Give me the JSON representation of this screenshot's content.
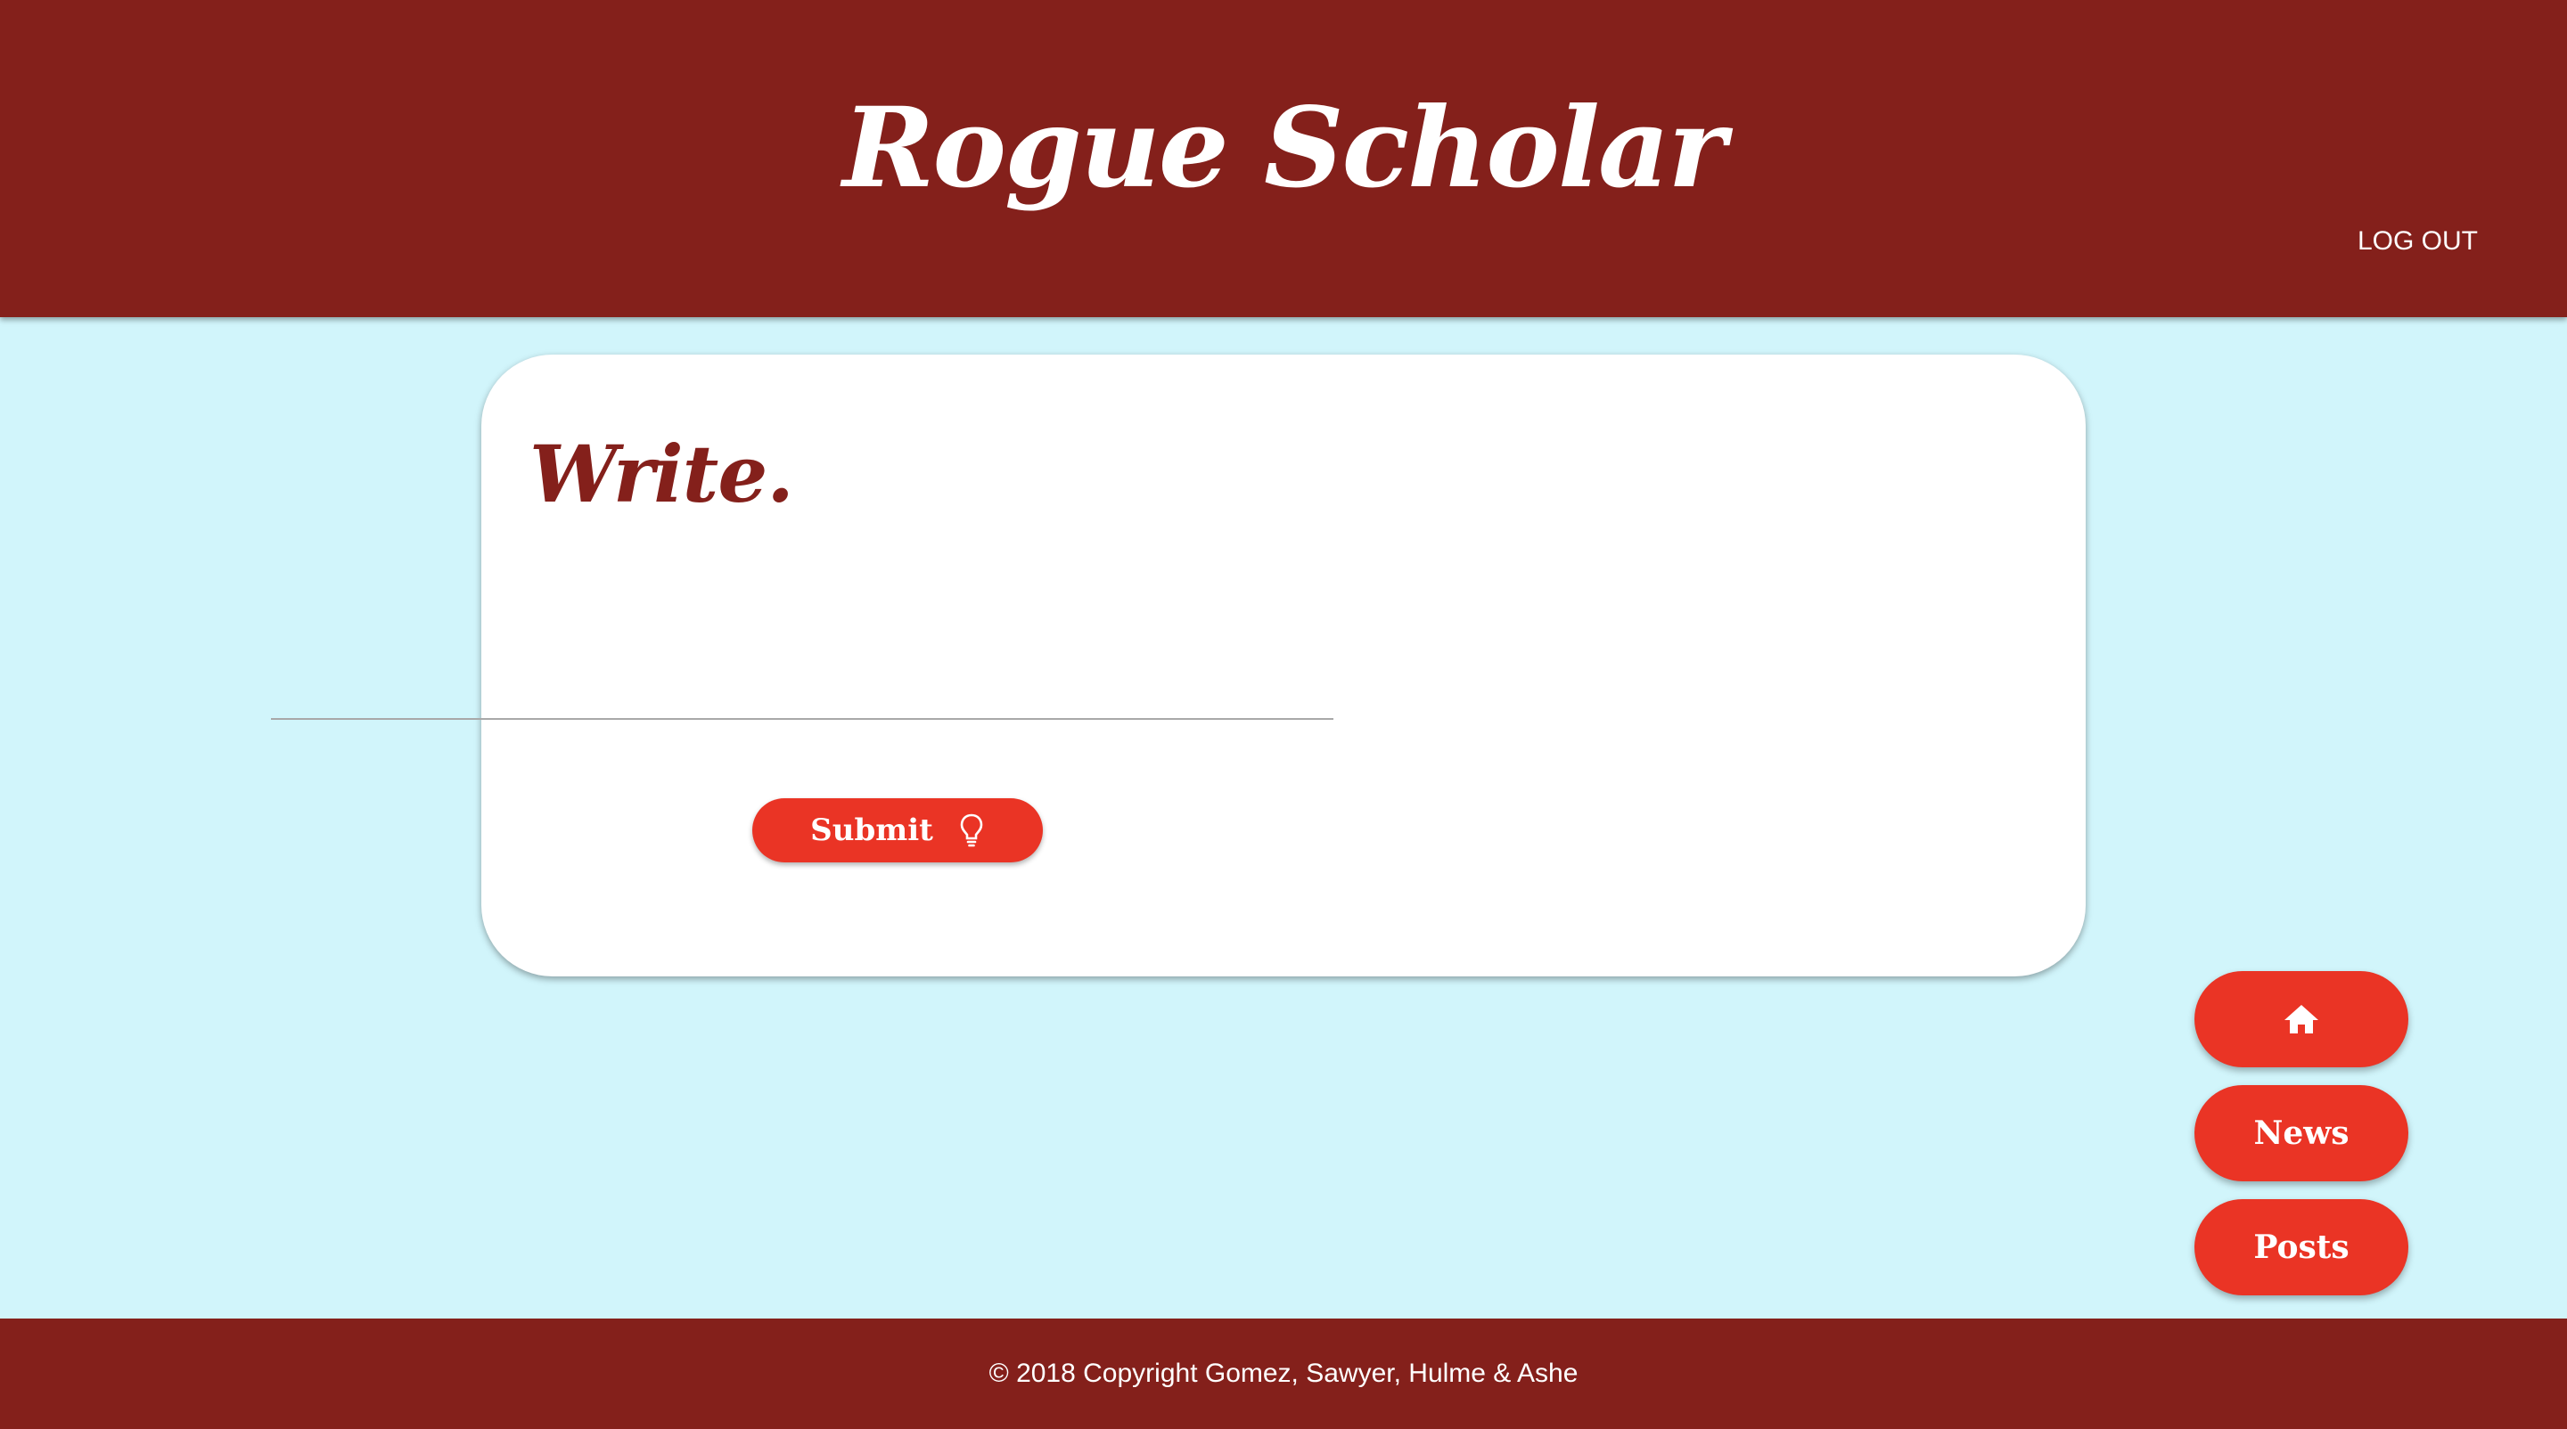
{
  "header": {
    "site_title": "Rogue Scholar",
    "logout_label": "LOG OUT"
  },
  "card": {
    "title": "Write.",
    "input_value": "",
    "input_placeholder": "",
    "submit_label": "Submit",
    "submit_icon": "lightbulb-icon"
  },
  "floating_nav": {
    "home_icon": "home-icon",
    "news_label": "News",
    "posts_label": "Posts"
  },
  "footer": {
    "copyright": "© 2018 Copyright Gomez, Sawyer, Hulme & Ashe"
  },
  "colors": {
    "header_bg": "#84201b",
    "page_bg": "#d1f5fb",
    "button_bg": "#ea3425",
    "title_color": "#84201b"
  }
}
